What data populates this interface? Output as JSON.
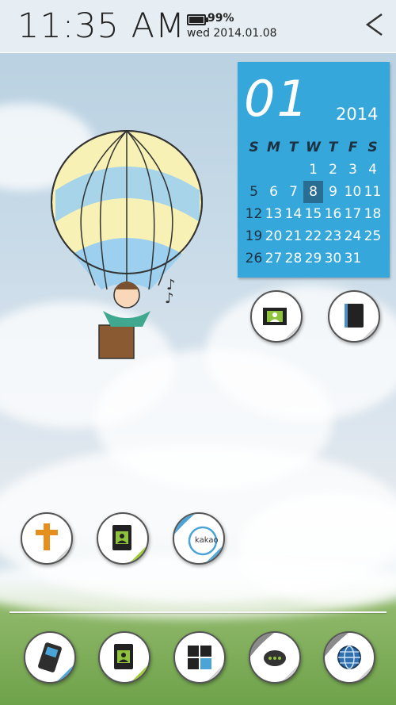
{
  "status_bar": {
    "time": "11:35 AM",
    "battery_percent": "99%",
    "date": "wed 2014.01.08"
  },
  "calendar": {
    "month": "01",
    "year": "2014",
    "weekdays": [
      "S",
      "M",
      "T",
      "W",
      "T",
      "F",
      "S"
    ],
    "weeks": [
      [
        "",
        "",
        "",
        "1",
        "2",
        "3",
        "4"
      ],
      [
        "5",
        "6",
        "7",
        "8",
        "9",
        "10",
        "11"
      ],
      [
        "12",
        "13",
        "14",
        "15",
        "16",
        "17",
        "18"
      ],
      [
        "19",
        "20",
        "21",
        "22",
        "23",
        "24",
        "25"
      ],
      [
        "26",
        "27",
        "28",
        "29",
        "30",
        "31",
        ""
      ]
    ],
    "today": "8",
    "colors": {
      "background": "#35a7da",
      "today_bg": "#2a6d93",
      "weekday_text": "#1d3040"
    }
  },
  "icons": {
    "photo_frame": "photo-frame-icon",
    "book": "book-icon",
    "cross": "cross-icon",
    "contacts": "contacts-icon",
    "kakao": "kakao-icon",
    "kakao_label": "kakao",
    "phone": "phone-icon",
    "contacts_dock": "contacts-icon",
    "apps": "apps-grid-icon",
    "messages": "messages-icon",
    "browser": "globe-icon"
  }
}
